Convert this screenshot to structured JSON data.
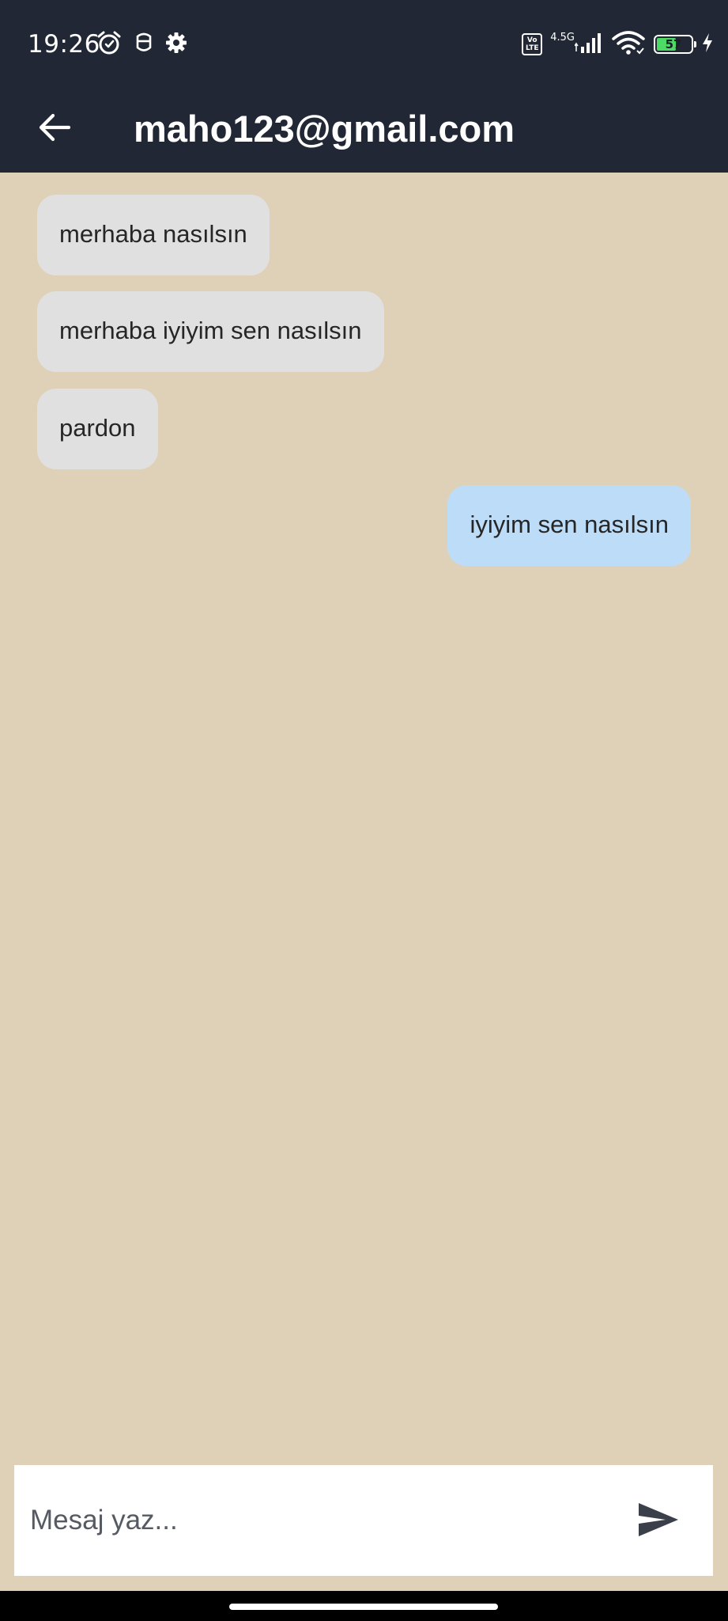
{
  "status_bar": {
    "time": "19:26",
    "left_icons": [
      "alarm-icon",
      "face-icon",
      "settings-gear-icon"
    ],
    "network": {
      "volte_top": "Vo",
      "volte_bottom": "LTE",
      "type": "4.5G"
    },
    "battery": {
      "level_label": "57",
      "level_fraction": 0.57,
      "charging": true,
      "fill_color": "#4cd964"
    }
  },
  "app_bar": {
    "title": "maho123@gmail.com",
    "back_icon": "arrow-left-icon",
    "background": "#212734"
  },
  "messages": [
    {
      "direction": "incoming",
      "text": "merhaba nasılsın"
    },
    {
      "direction": "incoming",
      "text": "merhaba iyiyim sen nasılsın"
    },
    {
      "direction": "incoming",
      "text": "pardon"
    },
    {
      "direction": "outgoing",
      "text": "iyiyim sen nasılsın"
    }
  ],
  "composer": {
    "placeholder": "Mesaj yaz...",
    "value": "",
    "send_icon": "send-icon"
  },
  "colors": {
    "chat_background": "#dfd1b8",
    "incoming_bubble": "#e0e0e0",
    "outgoing_bubble": "#bcdcf7"
  }
}
